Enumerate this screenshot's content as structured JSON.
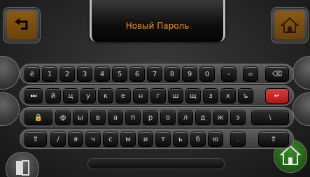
{
  "header": {
    "title": "Новый Пароль"
  },
  "keyboard": {
    "row1": [
      "ё",
      "1",
      "2",
      "3",
      "4",
      "5",
      "6",
      "7",
      "8",
      "9",
      "0",
      "-",
      "=",
      "⌫"
    ],
    "row2": [
      "⏭",
      "й",
      "ц",
      "у",
      "к",
      "е",
      "н",
      "г",
      "ш",
      "щ",
      "з",
      "х",
      "ъ",
      "↵"
    ],
    "row3": [
      "🔒",
      "ф",
      "ы",
      "в",
      "а",
      "п",
      "р",
      "о",
      "л",
      "д",
      "ж",
      "э",
      "\\"
    ],
    "row4": [
      "⇧",
      "/",
      "я",
      "ч",
      "с",
      "м",
      "и",
      "т",
      "ь",
      "б",
      "ю",
      ".",
      "⇧"
    ]
  },
  "icons": {
    "back": "back-arrow-icon",
    "home": "home-icon",
    "exit": "exit-door-icon",
    "install": "house-wrench-icon"
  },
  "colors": {
    "accent": "#ff9a1a",
    "button": "#8a5a12",
    "enter": "#e23b3b",
    "green": "#2e7a1f"
  }
}
